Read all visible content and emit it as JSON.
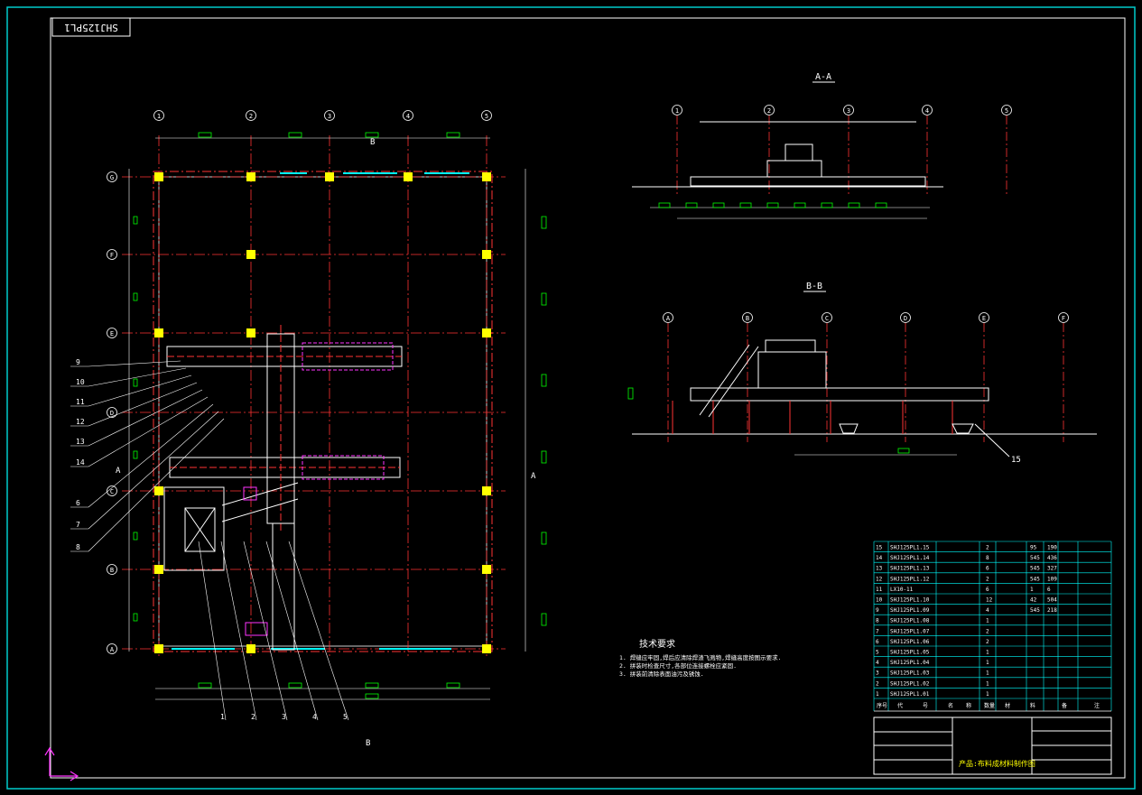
{
  "drawing": {
    "stamp": "SHJ125PL1",
    "section_aa": "A-A",
    "section_bb": "B-B",
    "section_mark_a": "A",
    "section_mark_b": "B",
    "tech_title": "技术要求",
    "tech_notes": [
      "1. 焊缝应牢固,焊后应清除焊渣飞溅物,焊缝高度按图示要求.",
      "2. 拼装时检查尺寸,各部位连接螺栓应紧固.",
      "3. 拼装前清除表面油污及锈蚀."
    ],
    "grid_cols_plan": [
      "1",
      "2",
      "3",
      "4",
      "5"
    ],
    "grid_rows_plan": [
      "G",
      "F",
      "E",
      "D",
      "C",
      "B",
      "A"
    ],
    "grid_cols_aa": [
      "1",
      "2",
      "3",
      "4",
      "5"
    ],
    "grid_cols_bb": [
      "A",
      "B",
      "C",
      "D",
      "E",
      "F"
    ],
    "callouts_left": [
      "9",
      "10",
      "11",
      "12",
      "13",
      "14",
      "6",
      "7",
      "8"
    ],
    "callouts_bottom": [
      "1",
      "2",
      "3",
      "4",
      "5"
    ],
    "callout_bb": "15"
  },
  "bom": {
    "rows": [
      {
        "no": "15",
        "code": "SHJ125PL1.15",
        "name": "",
        "qty": "2",
        "mat": "",
        "w1": "95",
        "w2": "190"
      },
      {
        "no": "14",
        "code": "SHJ125PL1.14",
        "name": "",
        "qty": "8",
        "mat": "",
        "w1": "545",
        "w2": "436"
      },
      {
        "no": "13",
        "code": "SHJ125PL1.13",
        "name": "",
        "qty": "6",
        "mat": "",
        "w1": "545",
        "w2": "327"
      },
      {
        "no": "12",
        "code": "SHJ125PL1.12",
        "name": "",
        "qty": "2",
        "mat": "",
        "w1": "545",
        "w2": "109"
      },
      {
        "no": "11",
        "code": "LX10-11",
        "name": "",
        "qty": "6",
        "mat": "",
        "w1": "1",
        "w2": "6"
      },
      {
        "no": "10",
        "code": "SHJ125PL1.10",
        "name": "",
        "qty": "12",
        "mat": "",
        "w1": "42",
        "w2": "504"
      },
      {
        "no": "9",
        "code": "SHJ125PL1.09",
        "name": "",
        "qty": "4",
        "mat": "",
        "w1": "545",
        "w2": "218"
      },
      {
        "no": "8",
        "code": "SHJ125PL1.08",
        "name": "",
        "qty": "1",
        "mat": "",
        "w1": "",
        "w2": ""
      },
      {
        "no": "7",
        "code": "SHJ125PL1.07",
        "name": "",
        "qty": "2",
        "mat": "",
        "w1": "",
        "w2": ""
      },
      {
        "no": "6",
        "code": "SHJ125PL1.06",
        "name": "",
        "qty": "2",
        "mat": "",
        "w1": "",
        "w2": ""
      },
      {
        "no": "5",
        "code": "SHJ125PL1.05",
        "name": "",
        "qty": "1",
        "mat": "",
        "w1": "",
        "w2": ""
      },
      {
        "no": "4",
        "code": "SHJ125PL1.04",
        "name": "",
        "qty": "1",
        "mat": "",
        "w1": "",
        "w2": ""
      },
      {
        "no": "3",
        "code": "SHJ125PL1.03",
        "name": "",
        "qty": "1",
        "mat": "",
        "w1": "",
        "w2": ""
      },
      {
        "no": "2",
        "code": "SHJ125PL1.02",
        "name": "",
        "qty": "1",
        "mat": "",
        "w1": "",
        "w2": ""
      },
      {
        "no": "1",
        "code": "SHJ125PL1.01",
        "name": "",
        "qty": "1",
        "mat": "",
        "w1": "",
        "w2": ""
      }
    ],
    "header": [
      "序号",
      "代",
      "号",
      "名",
      "称",
      "数量",
      "材",
      "料",
      "备",
      "注"
    ],
    "title_block_name": "产品:布料成材料制作图"
  }
}
